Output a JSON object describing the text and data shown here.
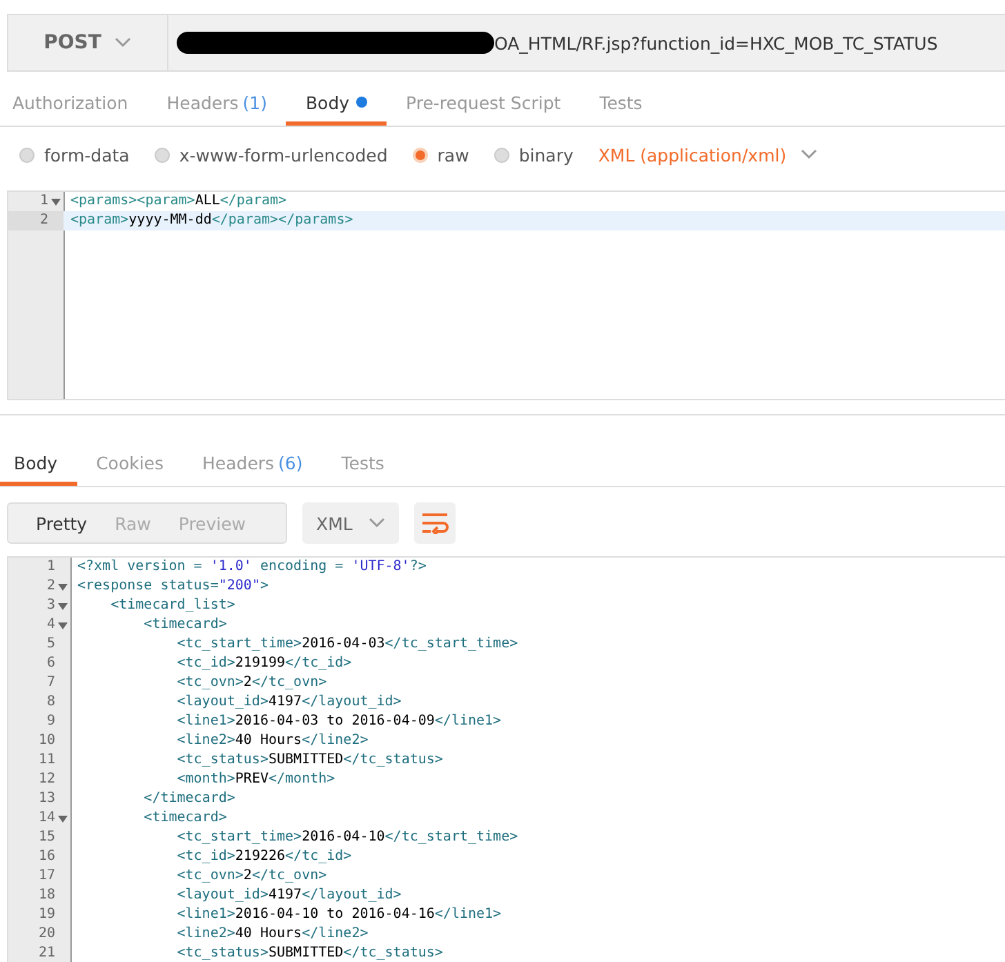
{
  "request": {
    "method": "POST",
    "url_redacted": true,
    "url": "OA_HTML/RF.jsp?function_id=HXC_MOB_TC_STATUS"
  },
  "request_tabs": [
    {
      "label": "Authorization",
      "selected": false
    },
    {
      "label": "Headers",
      "count": "(1)",
      "selected": false
    },
    {
      "label": "Body",
      "modified": true,
      "selected": true
    },
    {
      "label": "Pre-request Script",
      "selected": false
    },
    {
      "label": "Tests",
      "selected": false
    }
  ],
  "body_modes": [
    {
      "label": "form-data",
      "selected": false
    },
    {
      "label": "x-www-form-urlencoded",
      "selected": false
    },
    {
      "label": "raw",
      "selected": true
    },
    {
      "label": "binary",
      "selected": false
    }
  ],
  "content_type": "XML (application/xml)",
  "request_editor": {
    "lines": [
      {
        "number": "1",
        "text": "<params><param>ALL</param>",
        "foldable": true,
        "current": false
      },
      {
        "number": "2",
        "text": "<param>yyyy-MM-dd</param></params>",
        "foldable": false,
        "current": true
      }
    ]
  },
  "response_tabs": [
    {
      "label": "Body",
      "selected": true
    },
    {
      "label": "Cookies",
      "selected": false
    },
    {
      "label": "Headers",
      "count": "(6)",
      "selected": false
    },
    {
      "label": "Tests",
      "selected": false
    }
  ],
  "view_modes": [
    {
      "label": "Pretty",
      "selected": true
    },
    {
      "label": "Raw",
      "selected": false
    },
    {
      "label": "Preview",
      "selected": false
    }
  ],
  "format": "XML",
  "response_editor": {
    "lines": [
      {
        "number": "1",
        "text": "<?xml version = '1.0' encoding = 'UTF-8'?>",
        "foldable": false
      },
      {
        "number": "2",
        "text": "<response status=\"200\">",
        "foldable": true
      },
      {
        "number": "3",
        "text": "    <timecard_list>",
        "foldable": true
      },
      {
        "number": "4",
        "text": "        <timecard>",
        "foldable": true
      },
      {
        "number": "5",
        "text": "            <tc_start_time>2016-04-03</tc_start_time>",
        "foldable": false
      },
      {
        "number": "6",
        "text": "            <tc_id>219199</tc_id>",
        "foldable": false
      },
      {
        "number": "7",
        "text": "            <tc_ovn>2</tc_ovn>",
        "foldable": false
      },
      {
        "number": "8",
        "text": "            <layout_id>4197</layout_id>",
        "foldable": false
      },
      {
        "number": "9",
        "text": "            <line1>2016-04-03 to 2016-04-09</line1>",
        "foldable": false
      },
      {
        "number": "10",
        "text": "            <line2>40 Hours</line2>",
        "foldable": false
      },
      {
        "number": "11",
        "text": "            <tc_status>SUBMITTED</tc_status>",
        "foldable": false
      },
      {
        "number": "12",
        "text": "            <month>PREV</month>",
        "foldable": false
      },
      {
        "number": "13",
        "text": "        </timecard>",
        "foldable": false
      },
      {
        "number": "14",
        "text": "        <timecard>",
        "foldable": true
      },
      {
        "number": "15",
        "text": "            <tc_start_time>2016-04-10</tc_start_time>",
        "foldable": false
      },
      {
        "number": "16",
        "text": "            <tc_id>219226</tc_id>",
        "foldable": false
      },
      {
        "number": "17",
        "text": "            <tc_ovn>2</tc_ovn>",
        "foldable": false
      },
      {
        "number": "18",
        "text": "            <layout_id>4197</layout_id>",
        "foldable": false
      },
      {
        "number": "19",
        "text": "            <line1>2016-04-10 to 2016-04-16</line1>",
        "foldable": false
      },
      {
        "number": "20",
        "text": "            <line2>40 Hours</line2>",
        "foldable": false
      },
      {
        "number": "21",
        "text": "            <tc_status>SUBMITTED</tc_status>",
        "foldable": false
      }
    ]
  }
}
